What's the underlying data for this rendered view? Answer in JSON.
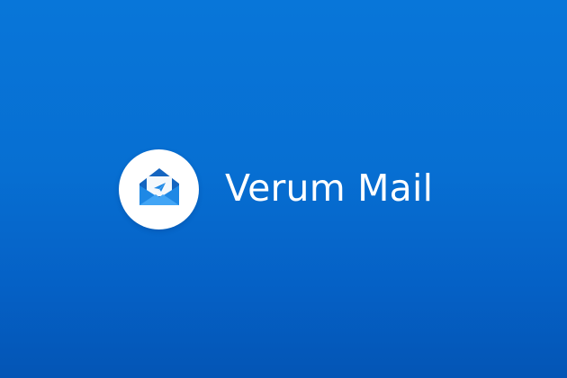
{
  "app": {
    "name": "Verum Mail",
    "logo_icon": "envelope-with-letter-icon"
  },
  "colors": {
    "background_top": "#0876d9",
    "background_bottom": "#0455b5",
    "logo_background": "#ffffff",
    "envelope_front": "#1e88e5",
    "envelope_back": "#1565c0",
    "text": "#ffffff"
  }
}
